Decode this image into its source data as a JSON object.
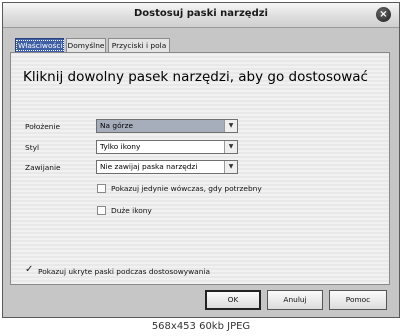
{
  "dialog": {
    "title": "Dostosuj paski narzędzi",
    "close_glyph": "×"
  },
  "tabs": [
    {
      "label": "Właściwości",
      "active": true
    },
    {
      "label": "Domyślne",
      "active": false
    },
    {
      "label": "Przyciski i pola",
      "active": false
    }
  ],
  "panel": {
    "heading": "Kliknij dowolny pasek narzędzi, aby go dostosować",
    "fields": [
      {
        "label": "Położenie",
        "value": "Na górze"
      },
      {
        "label": "Styl",
        "value": "Tylko ikony"
      },
      {
        "label": "Zawijanie",
        "value": "Nie zawijaj paska narzędzi"
      }
    ],
    "options": [
      {
        "label": "Pokazuj jedynie wówczas, gdy potrzebny",
        "checked": false
      },
      {
        "label": "Duże ikony",
        "checked": false
      }
    ],
    "show_hidden": {
      "label": "Pokazuj ukryte paski podczas dostosowywania",
      "checked": true,
      "glyph": "✓"
    }
  },
  "buttons": {
    "ok": "OK",
    "cancel": "Anuluj",
    "help": "Pomoc"
  },
  "caption": "568x453 60kb JPEG",
  "icons": {
    "close": "close-icon",
    "dropdown": "chevron-down-icon",
    "check": "checkmark-icon"
  }
}
